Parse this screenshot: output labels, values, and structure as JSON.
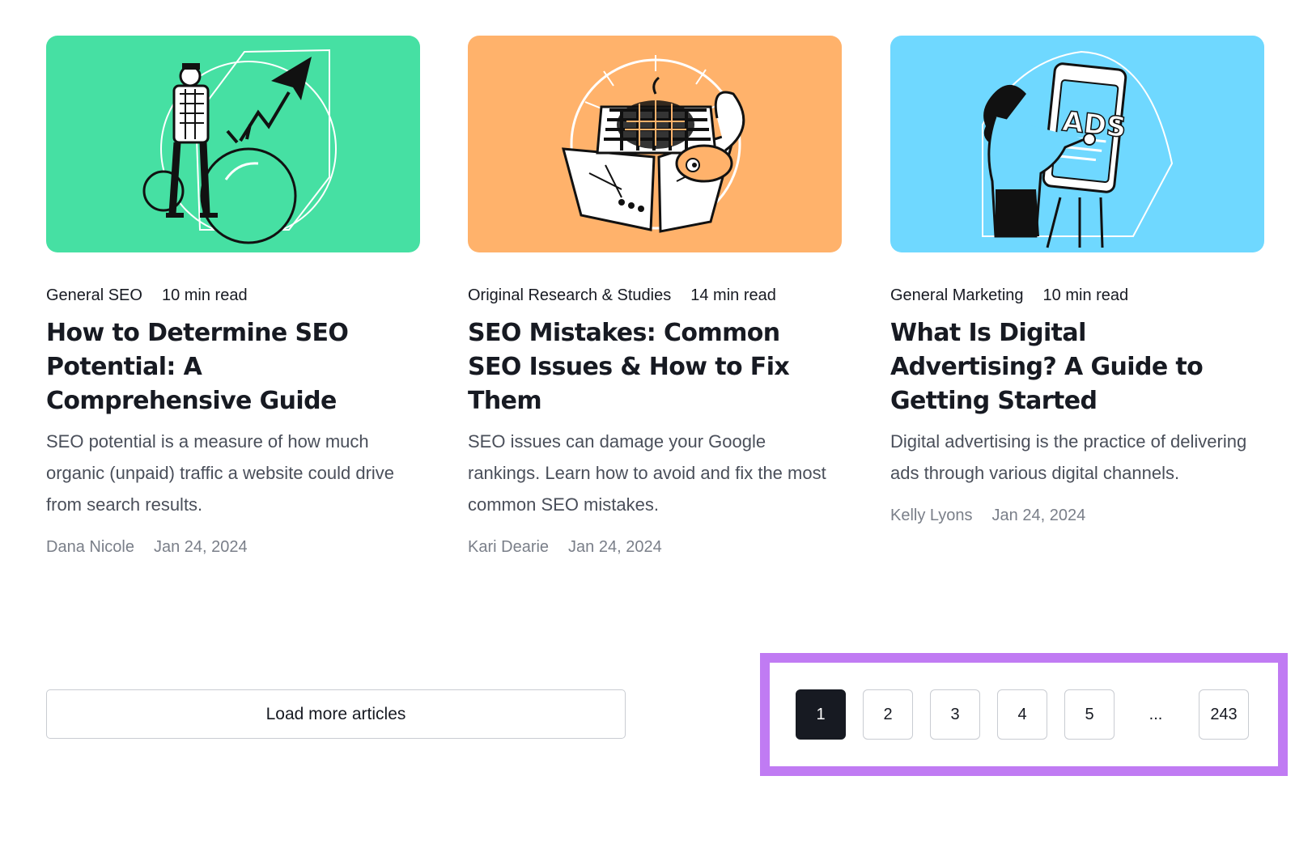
{
  "articles": [
    {
      "category": "General SEO",
      "read_time": "10 min read",
      "title": "How to Determine SEO Potential: A Comprehensive Guide",
      "description": "SEO potential is a measure of how much organic (unpaid) traffic a website could drive from search results.",
      "author": "Dana Nicole",
      "date": "Jan 24, 2024",
      "thumb_color": "#46e0a3"
    },
    {
      "category": "Original Research & Studies",
      "read_time": "14 min read",
      "title": "SEO Mistakes: Common SEO Issues & How to Fix Them",
      "description": "SEO issues can damage your Google rankings. Learn how to avoid and fix the most common SEO mistakes.",
      "author": "Kari Dearie",
      "date": "Jan 24, 2024",
      "thumb_color": "#ffb26b"
    },
    {
      "category": "General Marketing",
      "read_time": "10 min read",
      "title": "What Is Digital Advertising? A Guide to Getting Started",
      "description": "Digital advertising is the practice of delivering ads through various digital channels.",
      "author": "Kelly Lyons",
      "date": "Jan 24, 2024",
      "thumb_color": "#6fd8ff",
      "thumb_text": "ADS"
    }
  ],
  "load_more_label": "Load more articles",
  "pagination": {
    "pages": [
      "1",
      "2",
      "3",
      "4",
      "5"
    ],
    "current": "1",
    "ellipsis": "...",
    "last": "243"
  },
  "colors": {
    "highlight": "#c07bf3",
    "active_page": "#171a22"
  }
}
